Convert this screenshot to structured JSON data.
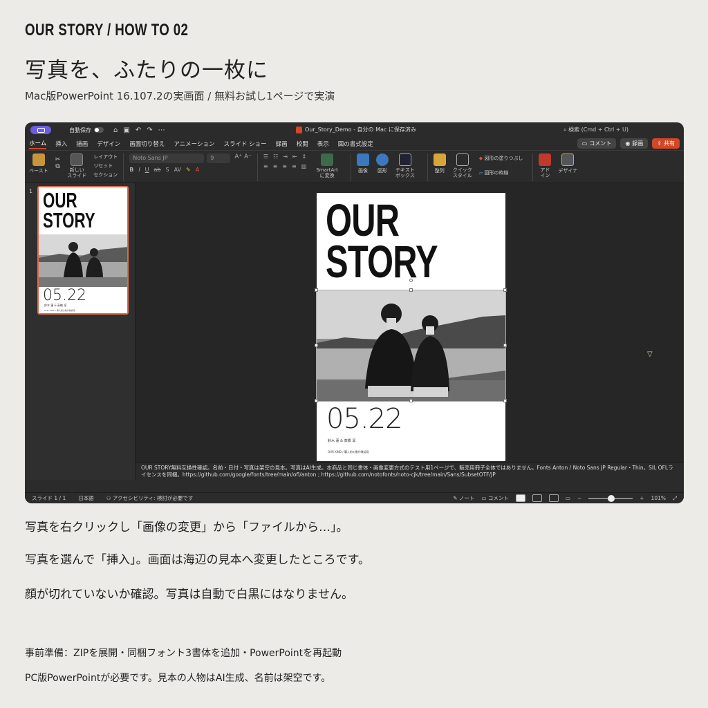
{
  "header": {
    "kicker": "OUR STORY / HOW TO 02",
    "headline": "写真を、ふたりの一枚に",
    "subline": "Mac版PowerPoint 16.107.2の実画面 / 無料お試し1ページで実演"
  },
  "app": {
    "autosave_label": "自動保存",
    "doc_title": "Our_Story_Demo - 自分の Mac に保存済み",
    "search_text": "検索 (Cmd + Ctrl + U)",
    "tabs": [
      "ホーム",
      "挿入",
      "描画",
      "デザイン",
      "画面切り替え",
      "アニメーション",
      "スライド ショー",
      "録画",
      "校閲",
      "表示",
      "図の書式設定"
    ],
    "comment_btn": "コメント",
    "record_btn": "録画",
    "share_btn": "共有",
    "ribbon": {
      "paste": "ペースト",
      "new_slide": "新しい\nスライド",
      "layout": "レイアウト",
      "reset": "リセット",
      "section": "セクション",
      "font_name": "Noto Sans JP",
      "font_size": "9",
      "smartart": "SmartArt\nに変換",
      "image": "画像",
      "shape": "図形",
      "textbox": "テキスト\nボックス",
      "arrange": "整列",
      "quick_style": "クイック\nスタイル",
      "shape_fill": "図形の塗りつぶし",
      "shape_outline": "図形の枠線",
      "addin": "アド\nイン",
      "designer": "デザイナ"
    },
    "thumbnail": {
      "number": "1",
      "title_line1": "OUR",
      "title_line2": "STORY",
      "date": "05.22",
      "names": "鈴木 蓮 & 高橋 凛",
      "foot": "OUR KIND / 購入前の動作確認用"
    },
    "slide": {
      "title_line1": "OUR",
      "title_line2": "STORY",
      "date": "05.22",
      "names": "鈴木 蓮 & 高橋 凛",
      "foot": "OUR KIND / 購入前の動作確認用"
    },
    "notes": "OUR STORY無料互換性確認。名前・日付・写真は架空の見本。写真はAI生成。本商品と同じ書体・画像変更方式のテスト用1ページで、販売用冊子全体ではありません。Fonts Anton / Noto Sans JP Regular・Thin。SIL OFLライセンスを同梱。https://github.com/google/fonts/tree/main/ofl/anton ; https://github.com/notofonts/noto-cjk/tree/main/Sans/SubsetOTF/JP",
    "status": {
      "slide_count": "スライド 1 / 1",
      "language": "日本語",
      "accessibility": "アクセシビリティ: 検討が必要です",
      "notes": "ノート",
      "comments": "コメント",
      "zoom": "101%"
    }
  },
  "instructions": {
    "line1": "写真を右クリックし「画像の変更」から「ファイルから…」。",
    "line2": "写真を選んで「挿入」。画面は海辺の見本へ変更したところです。",
    "line3": "顔が切れていないか確認。写真は自動で白黒にはなりません。"
  },
  "footer": {
    "line1": "事前準備：ZIPを展開・同梱フォント3書体を追加・PowerPointを再起動",
    "line2": "PC版PowerPointが必要です。見本の人物はAI生成、名前は架空です。"
  },
  "colors": {
    "accent": "#d24726",
    "page_bg": "#ecebe7",
    "app_bg": "#2b2b2b"
  }
}
